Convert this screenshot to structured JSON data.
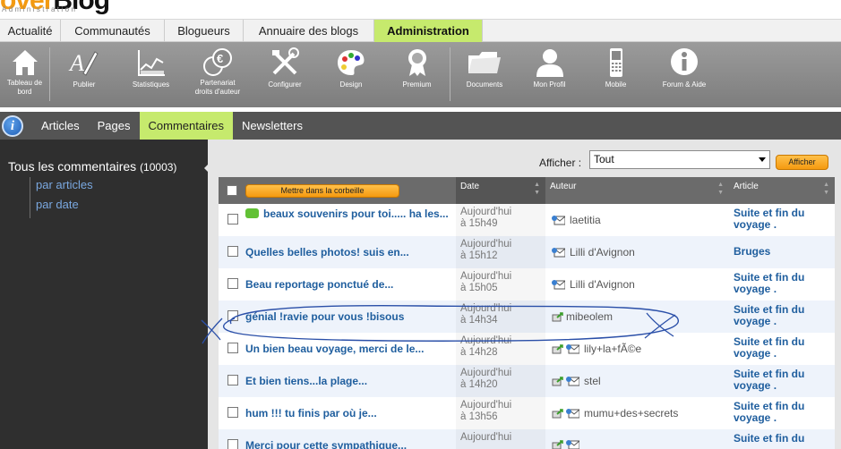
{
  "logo": {
    "prefix": "over",
    "suffix": "Blog",
    "sub": "Administration"
  },
  "top_tabs": [
    {
      "label": "Actualité"
    },
    {
      "label": "Communautés"
    },
    {
      "label": "Blogueurs"
    },
    {
      "label": "Annuaire des blogs"
    },
    {
      "label": "Administration"
    }
  ],
  "toolbar": [
    {
      "label": "Tableau de\nbord",
      "icon": "home-icon"
    },
    {
      "label": "Publier",
      "icon": "pen-icon"
    },
    {
      "label": "Statistiques",
      "icon": "chart-icon"
    },
    {
      "label": "Partenariat\ndroits d'auteur",
      "icon": "euro-icon"
    },
    {
      "label": "Configurer",
      "icon": "tools-icon"
    },
    {
      "label": "Design",
      "icon": "palette-icon"
    },
    {
      "label": "Premium",
      "icon": "medal-icon"
    },
    {
      "label": "Documents",
      "icon": "folder-icon"
    },
    {
      "label": "Mon Profil",
      "icon": "user-icon"
    },
    {
      "label": "Mobile",
      "icon": "mobile-icon"
    },
    {
      "label": "Forum & Aide",
      "icon": "info-icon"
    }
  ],
  "subnav": [
    {
      "label": "Articles"
    },
    {
      "label": "Pages"
    },
    {
      "label": "Commentaires"
    },
    {
      "label": "Newsletters"
    }
  ],
  "sidebar": {
    "title": "Tous les commentaires",
    "count": "(10003)",
    "links": [
      "par articles",
      "par date"
    ]
  },
  "filter": {
    "label": "Afficher :",
    "value": "Tout",
    "button": "Afficher"
  },
  "table": {
    "trash_button": "Mettre dans la corbeille",
    "headers": {
      "date": "Date",
      "author": "Auteur",
      "article": "Article"
    },
    "rows": [
      {
        "title": "beaux souvenirs pour toi..... ha les...",
        "has_bubble": true,
        "date1": "Aujourd'hui",
        "date2": "à 15h49",
        "author": "laetitia",
        "pub_icon": false,
        "article": "Suite et fin du voyage ."
      },
      {
        "title": "Quelles belles photos! suis en...",
        "has_bubble": false,
        "date1": "Aujourd'hui",
        "date2": "à 15h12",
        "author": "Lilli d'Avignon",
        "pub_icon": false,
        "article": "Bruges"
      },
      {
        "title": "Beau reportage ponctué de...",
        "has_bubble": false,
        "date1": "Aujourd'hui",
        "date2": "à 15h05",
        "author": "Lilli d'Avignon",
        "pub_icon": false,
        "article": "Suite et fin du voyage ."
      },
      {
        "title": "génial !ravie pour vous !bisous",
        "has_bubble": false,
        "date1": "Aujourd'hui",
        "date2": "à 14h34",
        "author": "mibeolem",
        "pub_icon": true,
        "article": "Suite et fin du voyage ."
      },
      {
        "title": "Un bien beau voyage, merci de le...",
        "has_bubble": false,
        "date1": "Aujourd'hui",
        "date2": "à 14h28",
        "author": "lily+la+fÃ©e",
        "pub_icon": true,
        "article": "Suite et fin du voyage ."
      },
      {
        "title": "Et bien tiens...la plage...",
        "has_bubble": false,
        "date1": "Aujourd'hui",
        "date2": "à 14h20",
        "author": "stel",
        "pub_icon": true,
        "article": "Suite et fin du voyage ."
      },
      {
        "title": "hum !!! tu finis par où je...",
        "has_bubble": false,
        "date1": "Aujourd'hui",
        "date2": "à 13h56",
        "author": "mumu+des+secrets",
        "pub_icon": true,
        "article": "Suite et fin du voyage ."
      },
      {
        "title": "Merci pour cette sympathique...",
        "has_bubble": false,
        "date1": "Aujourd'hui",
        "date2": "",
        "author": "",
        "pub_icon": true,
        "article": "Suite et fin du"
      }
    ]
  },
  "colors": {
    "active_green": "#c6ea6d",
    "link_blue": "#1f5e9e",
    "orange": "#f59a10",
    "annotation_blue": "#2a4fa8"
  }
}
